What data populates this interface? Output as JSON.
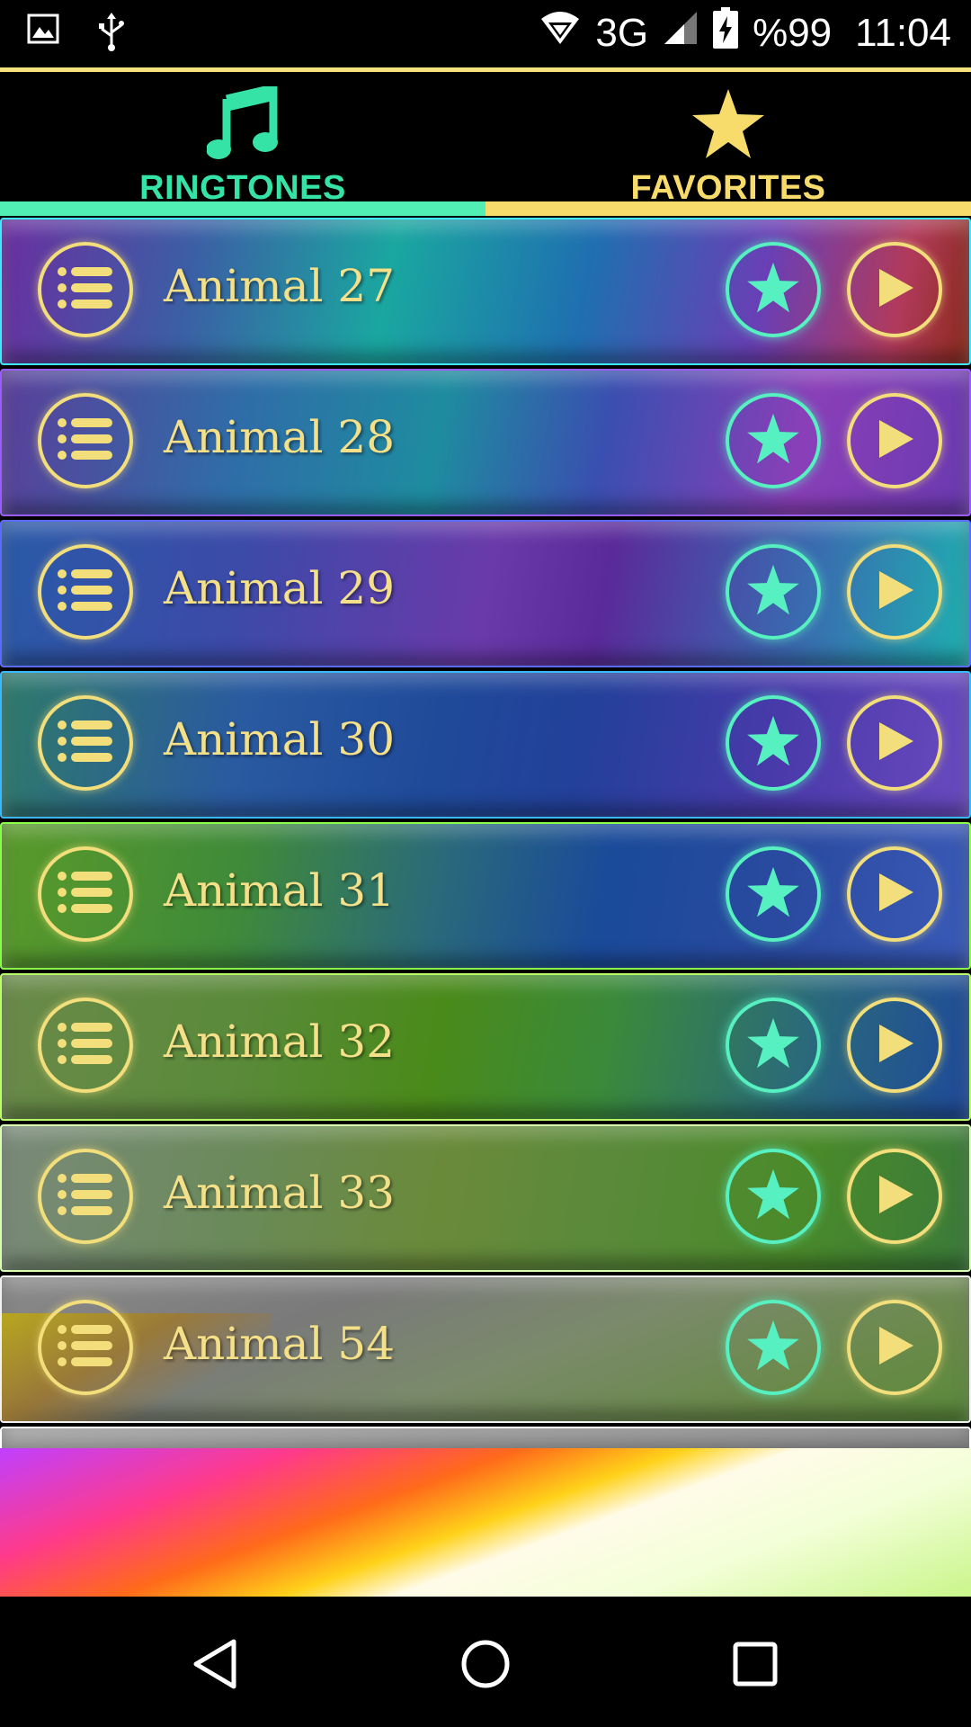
{
  "status_bar": {
    "network": "3G",
    "battery": "%99",
    "time": "11:04",
    "icons": [
      "image-icon",
      "usb-icon",
      "wifi-icon",
      "signal-icon",
      "battery-icon"
    ]
  },
  "tabs": [
    {
      "label": "RINGTONES",
      "icon": "music-note-icon",
      "color": "#35e3a6",
      "active": true
    },
    {
      "label": "FAVORITES",
      "icon": "star-icon",
      "color": "#f7dc6b",
      "active": false
    }
  ],
  "ringtones": [
    {
      "title": "Animal 27"
    },
    {
      "title": "Animal 28"
    },
    {
      "title": "Animal 29"
    },
    {
      "title": "Animal 30"
    },
    {
      "title": "Animal 31"
    },
    {
      "title": "Animal 32"
    },
    {
      "title": "Animal 33"
    },
    {
      "title": "Animal 54"
    }
  ],
  "colors": {
    "accent_gold": "#f2de7a",
    "accent_mint": "#57f0c0"
  },
  "nav": [
    "back-icon",
    "home-icon",
    "recents-icon"
  ]
}
